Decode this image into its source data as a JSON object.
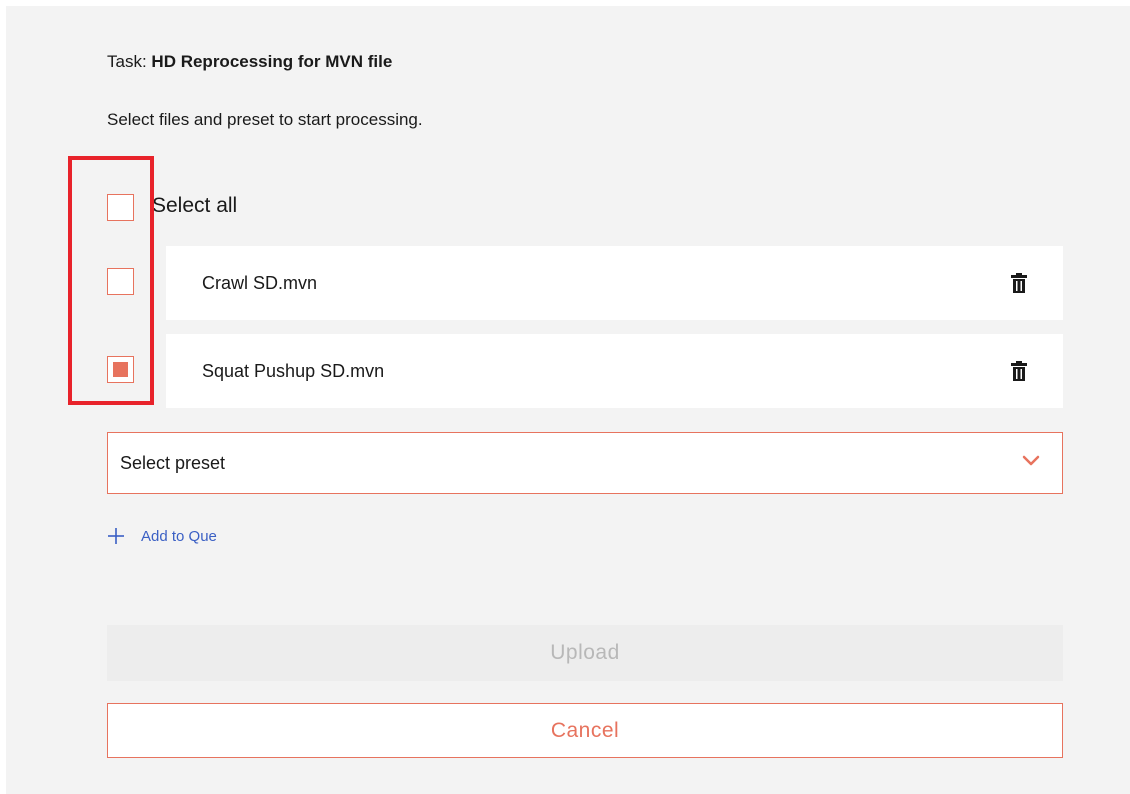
{
  "task": {
    "prefix": "Task:",
    "name": "HD Reprocessing for MVN file"
  },
  "instruction": "Select files and preset to start processing.",
  "select_all": {
    "label": "Select all",
    "checked": false
  },
  "files": [
    {
      "name": "Crawl SD.mvn",
      "checked": false,
      "action_icon": "trash-icon"
    },
    {
      "name": "Squat Pushup SD.mvn",
      "checked": true,
      "action_icon": "trash-icon"
    }
  ],
  "preset": {
    "placeholder": "Select preset",
    "icon": "chevron-down-icon"
  },
  "add_to_queue": {
    "label": "Add to Que",
    "icon": "plus-icon"
  },
  "buttons": {
    "upload": "Upload",
    "cancel": "Cancel"
  },
  "colors": {
    "accent": "#e7735e",
    "highlight": "#e8222a",
    "link": "#3a5fc4",
    "disabled_text": "#b8b8b8"
  }
}
